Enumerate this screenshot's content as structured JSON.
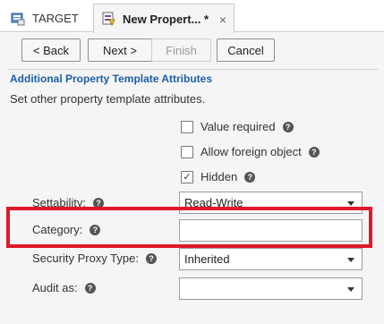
{
  "tabs": [
    {
      "label": "TARGET",
      "icon": "target-object-icon"
    },
    {
      "label": "New Propert... *",
      "icon": "property-template-icon",
      "close": "×"
    }
  ],
  "toolbar": {
    "back": "< Back",
    "next": "Next >",
    "finish": "Finish",
    "cancel": "Cancel"
  },
  "section": {
    "title": "Additional Property Template Attributes",
    "description": "Set other property template attributes."
  },
  "checkboxes": [
    {
      "label": "Value required",
      "checked": false
    },
    {
      "label": "Allow foreign object",
      "checked": false
    },
    {
      "label": "Hidden",
      "checked": true
    }
  ],
  "fields": {
    "settability": {
      "label": "Settability:",
      "value": "Read-Write"
    },
    "category": {
      "label": "Category:",
      "value": ""
    },
    "security_proxy_type": {
      "label": "Security Proxy Type:",
      "value": "Inherited"
    },
    "audit_as": {
      "label": "Audit as:",
      "value": ""
    }
  },
  "help_glyph": "?",
  "check_glyph": "✓",
  "colors": {
    "accent_title": "#1a5fa8",
    "highlight": "#e0182a",
    "panel_bg": "#f5f5f5"
  }
}
